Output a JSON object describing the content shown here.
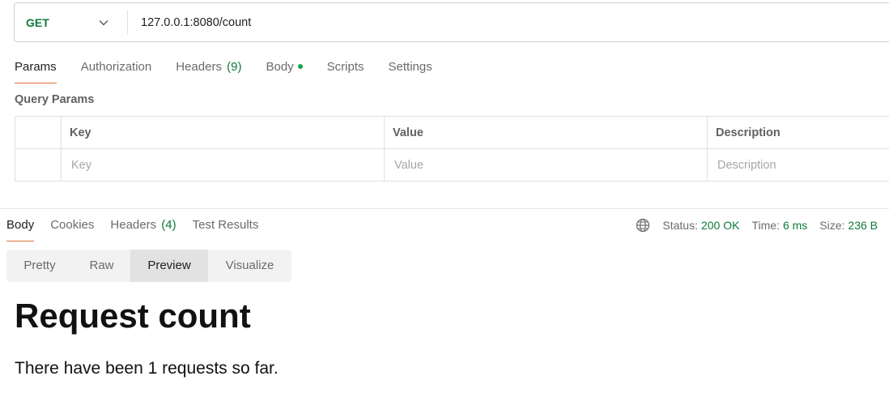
{
  "request": {
    "method": "GET",
    "url": "127.0.0.1:8080/count"
  },
  "request_tabs": [
    {
      "label": "Params",
      "count": "",
      "active": true
    },
    {
      "label": "Authorization",
      "count": ""
    },
    {
      "label": "Headers",
      "count": "(9)"
    },
    {
      "label": "Body",
      "count": "",
      "dot": true
    },
    {
      "label": "Scripts",
      "count": ""
    },
    {
      "label": "Settings",
      "count": ""
    }
  ],
  "query_params": {
    "title": "Query Params",
    "columns": [
      "Key",
      "Value",
      "Description"
    ],
    "placeholders": {
      "key": "Key",
      "value": "Value",
      "description": "Description"
    }
  },
  "response_tabs": [
    {
      "label": "Body",
      "count": "",
      "active": true
    },
    {
      "label": "Cookies",
      "count": ""
    },
    {
      "label": "Headers",
      "count": "(4)"
    },
    {
      "label": "Test Results",
      "count": ""
    }
  ],
  "status": {
    "status_label": "Status:",
    "status_value": "200 OK",
    "time_label": "Time:",
    "time_value": "6 ms",
    "size_label": "Size:",
    "size_value": "236 B"
  },
  "view_modes": [
    "Pretty",
    "Raw",
    "Preview",
    "Visualize"
  ],
  "active_view": "Preview",
  "preview": {
    "heading": "Request count",
    "text": "There have been 1 requests so far."
  },
  "colors": {
    "method_get": "#0f7a3a",
    "accent_underline": "#e0733a",
    "status_value": "#0f7a3a",
    "body_dot": "#12a84a"
  },
  "icons": [
    "chevron-down-icon",
    "globe-icon"
  ]
}
